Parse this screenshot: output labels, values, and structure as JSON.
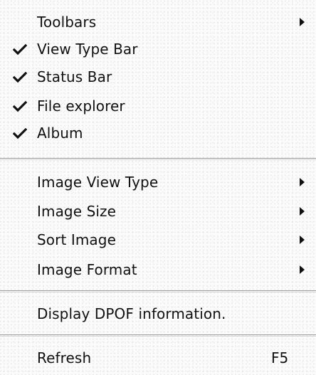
{
  "menu": {
    "group1": {
      "toolbars": {
        "label": "Toolbars",
        "checked": false,
        "has_submenu": true
      },
      "view_type_bar": {
        "label": "View Type Bar",
        "checked": true
      },
      "status_bar": {
        "label": "Status Bar",
        "checked": true
      },
      "file_explorer": {
        "label": "File explorer",
        "checked": true
      },
      "album": {
        "label": "Album",
        "checked": true
      }
    },
    "group2": {
      "image_view_type": {
        "label": "Image View Type",
        "has_submenu": true
      },
      "image_size": {
        "label": "Image Size",
        "has_submenu": true
      },
      "sort_image": {
        "label": "Sort Image",
        "has_submenu": true
      },
      "image_format": {
        "label": "Image Format",
        "has_submenu": true
      }
    },
    "group3": {
      "display_dpof": {
        "label": "Display DPOF information."
      }
    },
    "group4": {
      "refresh": {
        "label": "Refresh",
        "shortcut": "F5"
      }
    },
    "icons": {
      "check": "checkmark-icon",
      "submenu": "submenu-arrow-icon"
    }
  }
}
